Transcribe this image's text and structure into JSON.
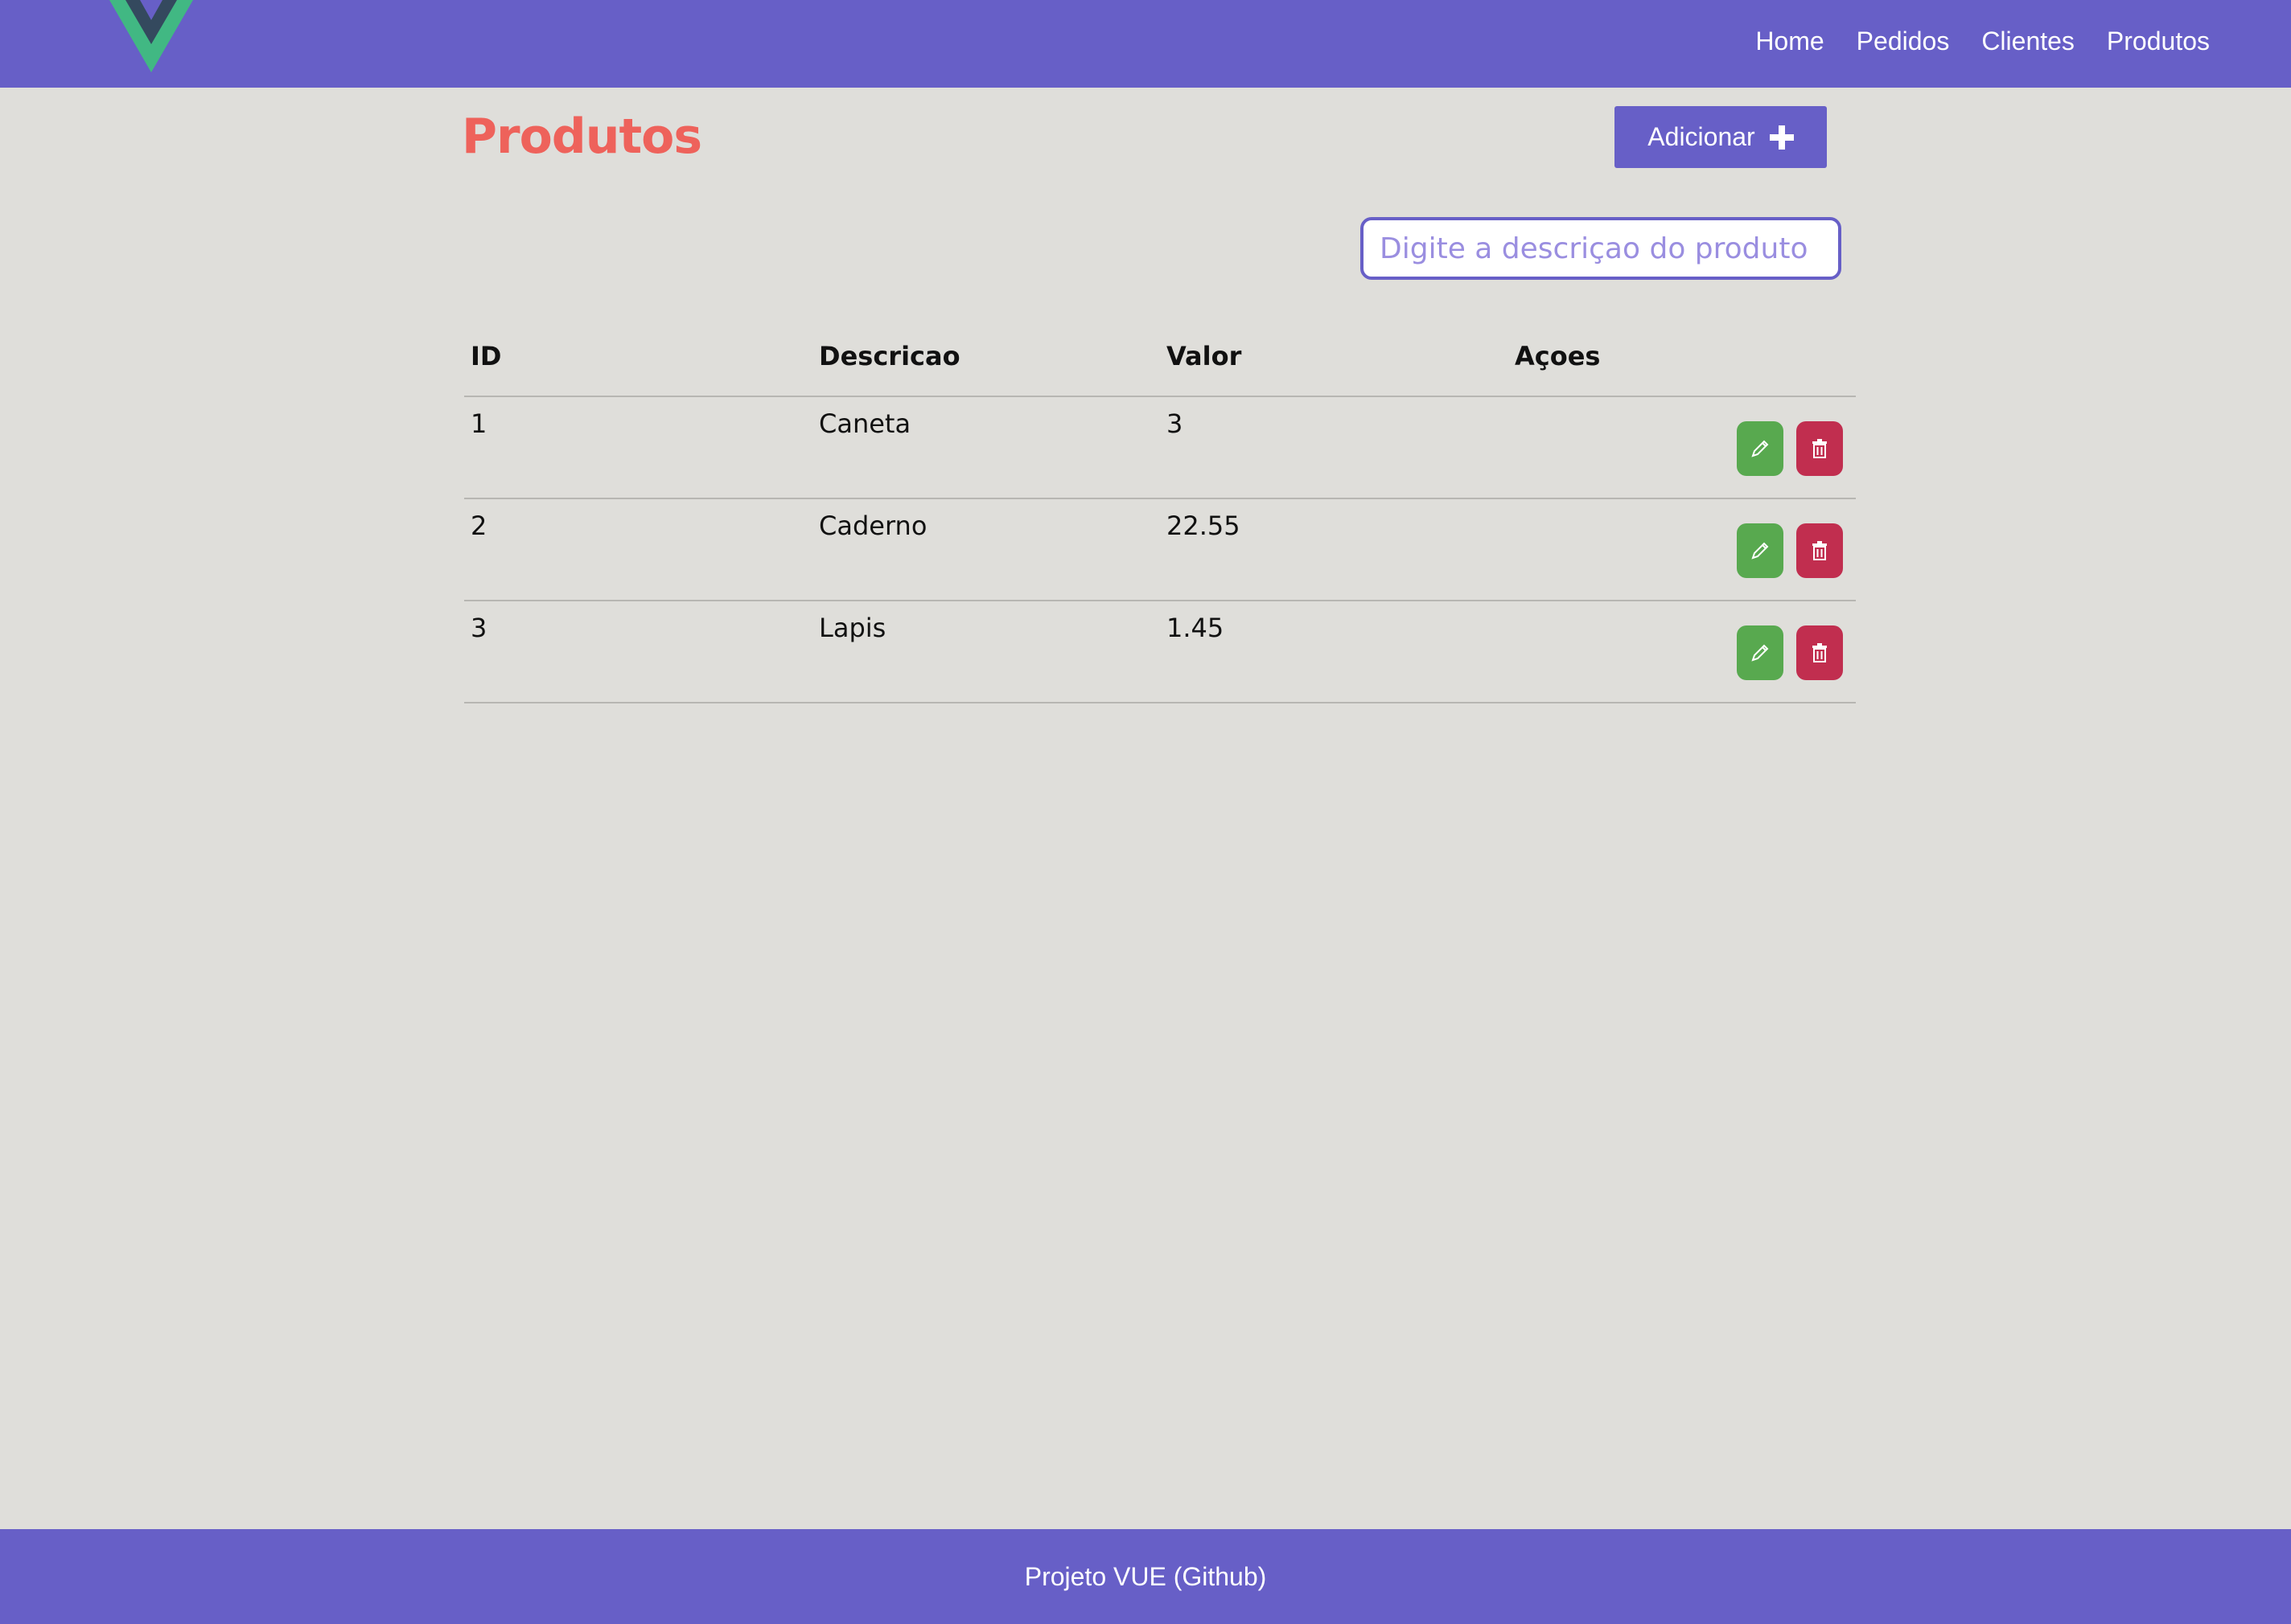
{
  "header": {
    "logo_icon": "vue-logo-icon",
    "nav": [
      "Home",
      "Pedidos",
      "Clientes",
      "Produtos"
    ]
  },
  "main": {
    "title": "Produtos",
    "add_button": {
      "label": "Adicionar",
      "icon": "plus-icon"
    },
    "search": {
      "placeholder": "Digite a descriçao do produto",
      "value": ""
    },
    "table": {
      "columns": [
        "ID",
        "Descricao",
        "Valor",
        "Açoes"
      ],
      "rows": [
        {
          "id": "1",
          "descricao": "Caneta",
          "valor": "3"
        },
        {
          "id": "2",
          "descricao": "Caderno",
          "valor": "22.55"
        },
        {
          "id": "3",
          "descricao": "Lapis",
          "valor": "1.45"
        }
      ],
      "row_actions": [
        "pencil-icon",
        "trash-icon"
      ]
    }
  },
  "footer": {
    "text": "Projeto VUE (Github)"
  },
  "colors": {
    "brand": "#675fc7",
    "title": "#ee625b",
    "background": "#dfdeda",
    "edit": "#58a94f",
    "delete": "#c12e4f"
  }
}
